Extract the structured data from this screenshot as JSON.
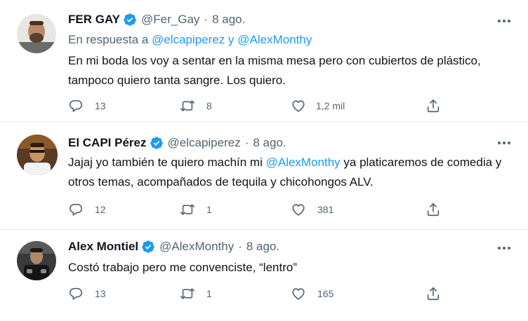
{
  "colors": {
    "accent": "#1d9bf0",
    "muted": "#536471",
    "text": "#0f1419",
    "verified": "#1d9bf0"
  },
  "tweets": [
    {
      "name": "FER GAY",
      "handle": "@Fer_Gay",
      "dot": "·",
      "time": "8 ago.",
      "reply_prefix": "En respuesta a",
      "reply_user1": "@elcapiperez",
      "reply_and": "y",
      "reply_user2": "@AlexMonthy",
      "text": "En mi boda los voy a sentar en la misma mesa pero con cubiertos de plástico, tampoco quiero tanta sangre. Los quiero.",
      "replies": "13",
      "retweets": "8",
      "likes": "1,2 mil"
    },
    {
      "name": "El CAPI Pérez",
      "handle": "@elcapiperez",
      "dot": "·",
      "time": "8 ago.",
      "text_before": "Jajaj yo también te quiero machín mi ",
      "text_mention": "@AlexMonthy",
      "text_after": " ya platicaremos de comedia y otros temas, acompañados de tequila y chicohongos ALV.",
      "replies": "12",
      "retweets": "1",
      "likes": "381"
    },
    {
      "name": "Alex Montiel",
      "handle": "@AlexMonthy",
      "dot": "·",
      "time": "8 ago.",
      "text": "Costó trabajo pero me convenciste, “lentro”",
      "replies": "13",
      "retweets": "1",
      "likes": "165"
    }
  ],
  "icons": {
    "reply": "reply-icon",
    "retweet": "retweet-icon",
    "like": "heart-icon",
    "share": "share-icon",
    "more": "more-icon",
    "verified": "verified-badge-icon"
  }
}
